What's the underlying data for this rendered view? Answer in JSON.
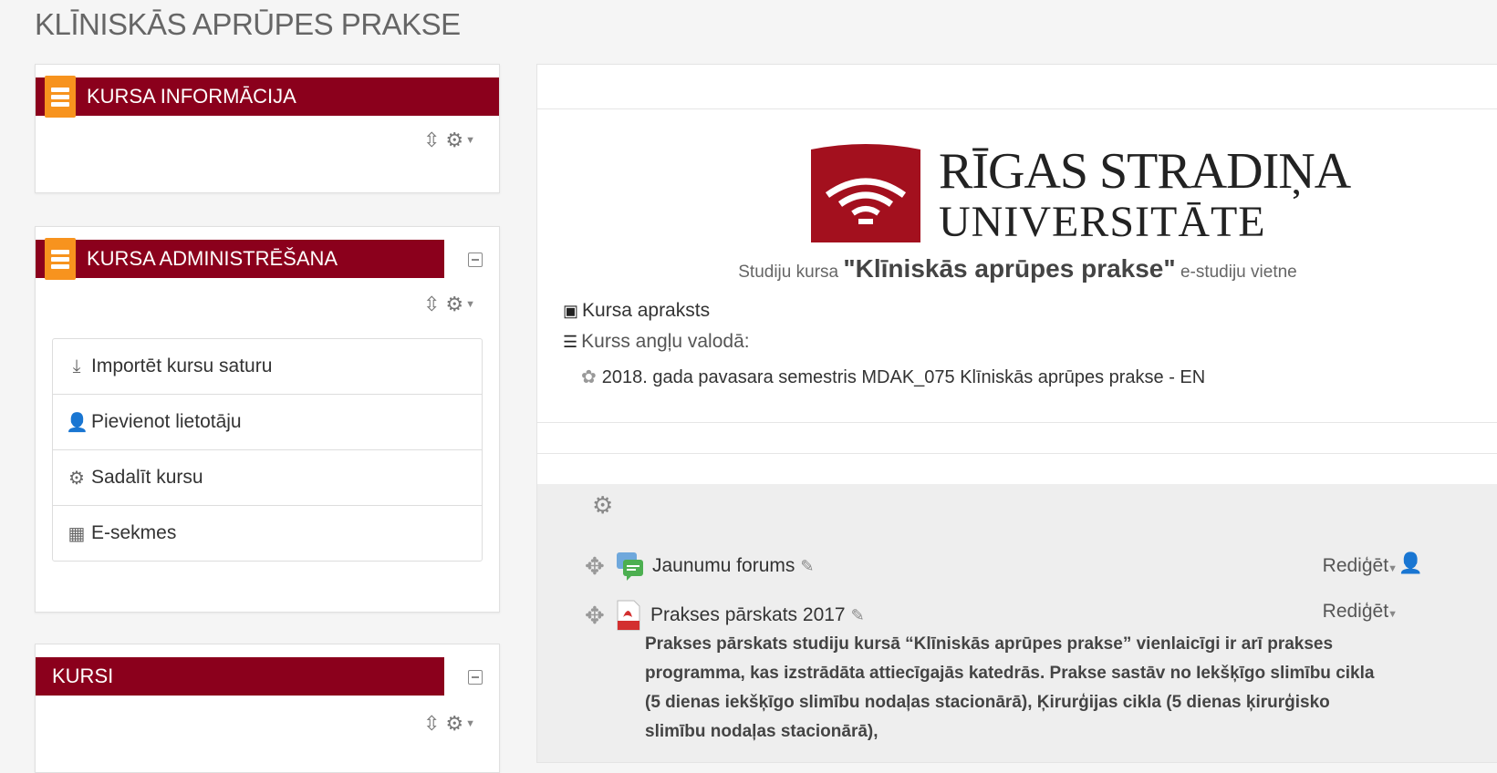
{
  "page": {
    "title": "KLĪNISKĀS APRŪPES PRAKSE"
  },
  "blocks": {
    "info": {
      "title": "KURSA INFORMĀCIJA"
    },
    "admin": {
      "title": "KURSA ADMINISTRĒŠANA",
      "items": [
        {
          "label": "Importēt kursu saturu",
          "icon": "import-icon"
        },
        {
          "label": "Pievienot lietotāju",
          "icon": "add-user-icon"
        },
        {
          "label": "Sadalīt kursu",
          "icon": "gear-icon"
        },
        {
          "label": "E-sekmes",
          "icon": "grades-table-icon"
        }
      ]
    },
    "courses": {
      "title": "KURSI"
    }
  },
  "main": {
    "logo": {
      "line1": "RĪGAS STRADIŅA",
      "line2": "UNIVERSITĀTE"
    },
    "subtitle": {
      "prefix": "Studiju kursa",
      "course": "\"Klīniskās aprūpes prakse\"",
      "suffix": "e-studiju vietne"
    },
    "course_description_link": "Kursa apraksts",
    "english_label": "Kurss angļu valodā:",
    "english_course": "2018. gada pavasara semestris MDAK_075 Klīniskās aprūpes prakse - EN",
    "activities": [
      {
        "name": "Jaunumu forums",
        "edit": "Rediģēt",
        "icon": "forum-icon"
      },
      {
        "name": "Prakses pārskats 2017",
        "edit": "Rediģēt",
        "icon": "pdf-icon"
      }
    ],
    "description": "Prakses pārskats studiju kursā “Klīniskās aprūpes prakse” vienlaicīgi ir arī prakses programma, kas izstrādāta attiecīgajās katedrās. Prakse sastāv no Iekšķīgo slimību cikla (5 dienas iekšķīgo slimību nodaļas stacionārā), Ķirurģijas cikla (5 dienas ķirurģisko slimību nodaļas stacionārā),"
  },
  "colors": {
    "header_red": "#8b001c",
    "block_icon_orange": "#f7931e",
    "logo_red": "#a3101e"
  }
}
